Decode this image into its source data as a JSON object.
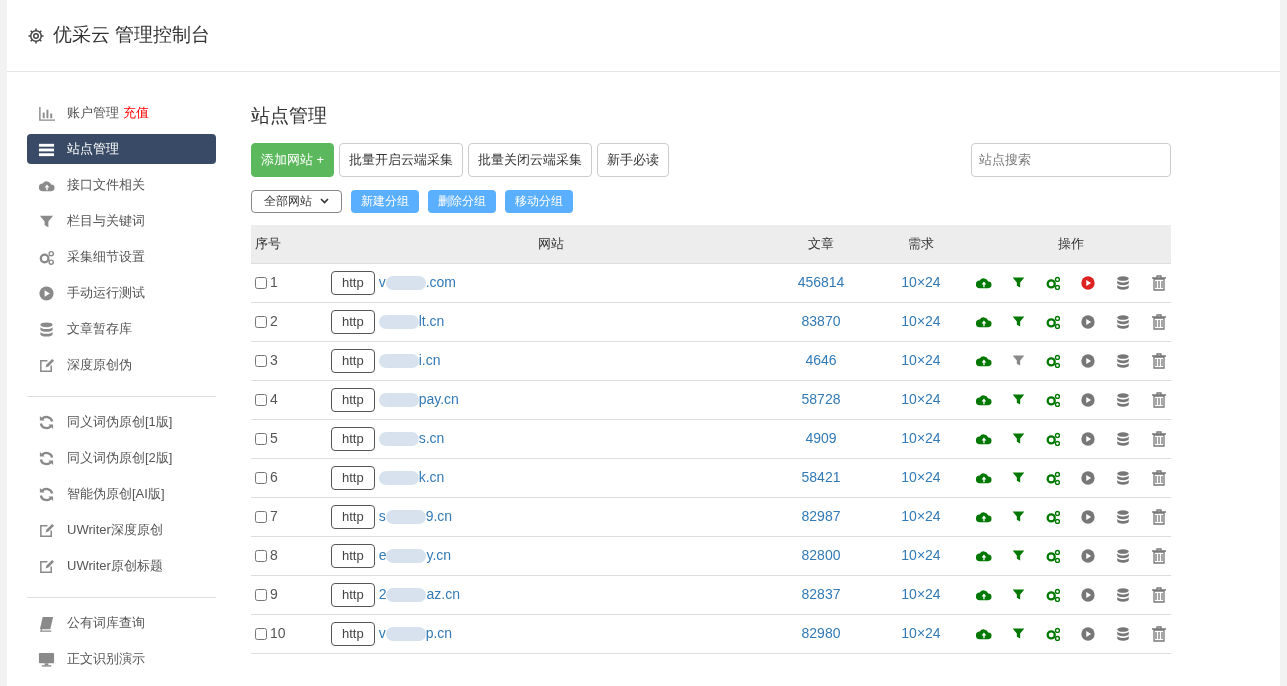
{
  "header": {
    "title": "优采云 管理控制台"
  },
  "sidebar": {
    "groups": [
      [
        {
          "kind": "chart",
          "label": "账户管理",
          "badge": "充值",
          "selected": false
        },
        {
          "kind": "server",
          "label": "站点管理",
          "selected": true
        },
        {
          "kind": "cloud",
          "label": "接口文件相关",
          "selected": false
        },
        {
          "kind": "filter",
          "label": "栏目与关键词",
          "selected": false
        },
        {
          "kind": "gears",
          "label": "采集细节设置",
          "selected": false
        },
        {
          "kind": "play",
          "label": "手动运行测试",
          "selected": false
        },
        {
          "kind": "database",
          "label": "文章暂存库",
          "selected": false
        },
        {
          "kind": "edit",
          "label": "深度原创伪",
          "selected": false
        }
      ],
      [
        {
          "kind": "refresh",
          "label": "同义词伪原创[1版]",
          "selected": false
        },
        {
          "kind": "refresh",
          "label": "同义词伪原创[2版]",
          "selected": false
        },
        {
          "kind": "refresh",
          "label": "智能伪原创[AI版]",
          "selected": false
        },
        {
          "kind": "edit",
          "label": "UWriter深度原创",
          "selected": false
        },
        {
          "kind": "edit",
          "label": "UWriter原创标题",
          "selected": false
        }
      ],
      [
        {
          "kind": "book",
          "label": "公有词库查询",
          "selected": false
        },
        {
          "kind": "monitor",
          "label": "正文识别演示",
          "selected": false
        }
      ]
    ]
  },
  "main": {
    "title": "站点管理",
    "toolbar": [
      {
        "kind": "primary",
        "label": "添加网站 +"
      },
      {
        "kind": "default",
        "label": "批量开启云端采集"
      },
      {
        "kind": "default",
        "label": "批量关闭云端采集"
      },
      {
        "kind": "default",
        "label": "新手必读"
      }
    ],
    "search": {
      "placeholder": "站点搜索"
    },
    "group_select": {
      "value": "全部网站"
    },
    "group_buttons": [
      "新建分组",
      "删除分组",
      "移动分组"
    ],
    "table": {
      "columns": [
        "序号",
        "网站",
        "文章",
        "需求",
        "操作"
      ],
      "rows": [
        {
          "index": "1",
          "checked": false,
          "scheme": "http",
          "domain_start": "v",
          "domain_end": ".com",
          "articles": "456814",
          "demand": "10×24",
          "filter_on": true,
          "running": true
        },
        {
          "index": "2",
          "checked": false,
          "scheme": "http",
          "domain_start": "",
          "domain_end": "lt.cn",
          "articles": "83870",
          "demand": "10×24",
          "filter_on": true,
          "running": false
        },
        {
          "index": "3",
          "checked": false,
          "scheme": "http",
          "domain_start": "",
          "domain_end": "i.cn",
          "articles": "4646",
          "demand": "10×24",
          "filter_on": false,
          "running": false
        },
        {
          "index": "4",
          "checked": false,
          "scheme": "http",
          "domain_start": "",
          "domain_end": "pay.cn",
          "articles": "58728",
          "demand": "10×24",
          "filter_on": true,
          "running": false
        },
        {
          "index": "5",
          "checked": false,
          "scheme": "http",
          "domain_start": "",
          "domain_end": "s.cn",
          "articles": "4909",
          "demand": "10×24",
          "filter_on": true,
          "running": false
        },
        {
          "index": "6",
          "checked": false,
          "scheme": "http",
          "domain_start": "",
          "domain_end": "k.cn",
          "articles": "58421",
          "demand": "10×24",
          "filter_on": true,
          "running": false
        },
        {
          "index": "7",
          "checked": false,
          "scheme": "http",
          "domain_start": "s",
          "domain_end": "9.cn",
          "articles": "82987",
          "demand": "10×24",
          "filter_on": true,
          "running": false
        },
        {
          "index": "8",
          "checked": false,
          "scheme": "http",
          "domain_start": "e",
          "domain_end": "y.cn",
          "articles": "82800",
          "demand": "10×24",
          "filter_on": true,
          "running": false
        },
        {
          "index": "9",
          "checked": false,
          "scheme": "http",
          "domain_start": "2",
          "domain_end": "az.cn",
          "articles": "82837",
          "demand": "10×24",
          "filter_on": true,
          "running": false
        },
        {
          "index": "10",
          "checked": false,
          "scheme": "http",
          "domain_start": "v",
          "domain_end": "p.cn",
          "articles": "82980",
          "demand": "10×24",
          "filter_on": true,
          "running": false
        }
      ]
    }
  }
}
